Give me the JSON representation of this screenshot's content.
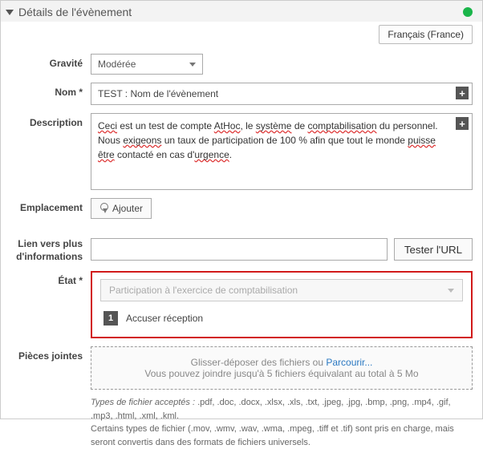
{
  "header": {
    "title": "Détails de l'évènement",
    "language_button": "Français (France)"
  },
  "labels": {
    "severity": "Gravité",
    "name": "Nom *",
    "description": "Description",
    "location": "Emplacement",
    "link": "Lien vers plus d'informations",
    "state": "État *",
    "attachments": "Pièces jointes"
  },
  "severity": {
    "value": "Modérée"
  },
  "name": {
    "value": "TEST : Nom de l'évènement"
  },
  "description": {
    "l1a": "Ceci",
    "l1b": " est un test de compte ",
    "l1c": "AtHoc",
    "l1d": ", le ",
    "l1e": "système",
    "l1f": " de ",
    "l1g": "comptabilisation",
    "l1h": " du personnel.",
    "l2a": "Nous ",
    "l2b": "exigeons",
    "l2c": " un taux de participation de 100 % afin que tout le monde ",
    "l2d": "puisse",
    "l3a": "être",
    "l3b": " contacté en cas d'",
    "l3c": "urgence",
    "l3d": "."
  },
  "location": {
    "add_label": "Ajouter"
  },
  "link": {
    "test_label": "Tester l'URL"
  },
  "state": {
    "select_value": "Participation à l'exercice de comptabilisation",
    "item_num": "1",
    "item_label": "Accuser réception"
  },
  "attachments": {
    "drop_prefix": "Glisser-déposer des fichiers ou ",
    "browse": "Parcourir...",
    "drop_hint": "Vous pouvez joindre jusqu'à 5 fichiers équivalant au total à 5 Mo",
    "types_label": "Types de fichier acceptés :",
    "types_list": " .pdf, .doc, .docx, .xlsx, .xls, .txt, .jpeg, .jpg, .bmp, .png, .mp4, .gif, .mp3, .html, .xml, .kml.",
    "note": "Certains types de fichier (.mov, .wmv, .wav, .wma, .mpeg, .tiff et .tif) sont pris en charge, mais seront convertis dans des formats de fichiers universels."
  }
}
